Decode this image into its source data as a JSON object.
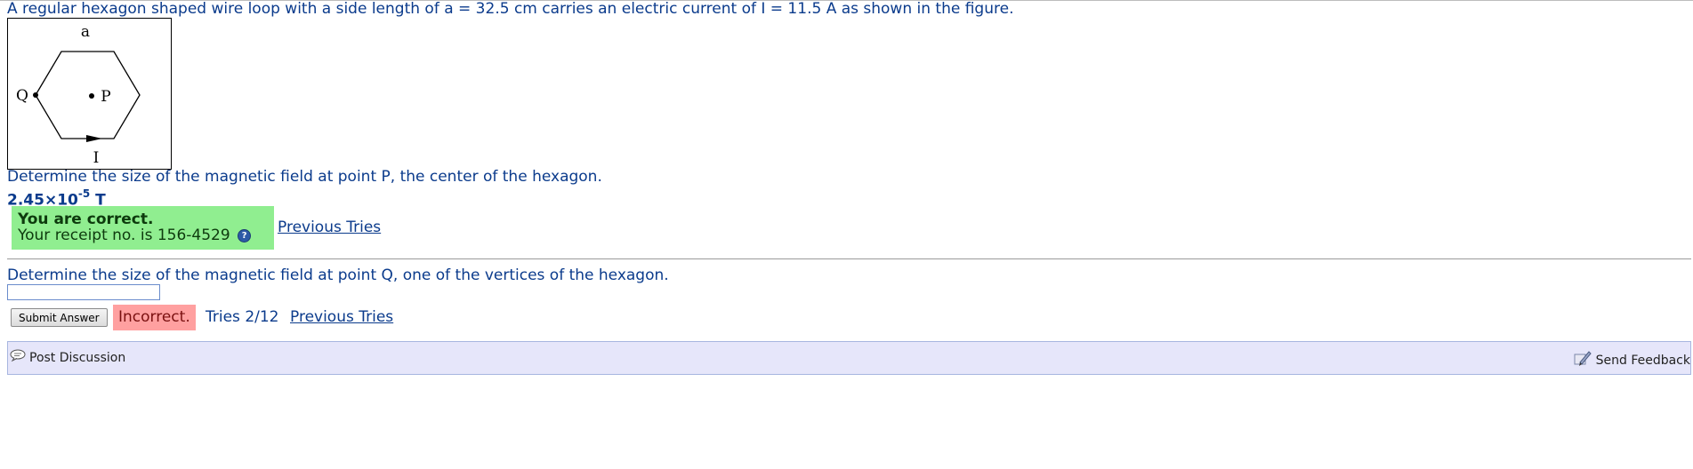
{
  "problem": {
    "statement": "A regular hexagon shaped wire loop with a side length of a = 32.5 cm carries an electric current of I = 11.5 A as shown in the figure."
  },
  "figure": {
    "label_a": "a",
    "label_q": "Q",
    "label_p": "P",
    "label_i": "I"
  },
  "part1": {
    "question": "Determine the size of the magnetic field at point P, the center of the hexagon.",
    "answer_mantissa": "2.45×10",
    "answer_exponent": "-5",
    "answer_unit": "T",
    "status_title": "You are correct.",
    "receipt": "Your receipt no. is 156-4529",
    "help_icon": "question-circle-icon",
    "previous_tries": "Previous Tries"
  },
  "part2": {
    "question": "Determine the size of the magnetic field at point Q, one of the vertices of the hexagon.",
    "input_value": "",
    "submit_label": "Submit Answer",
    "status": "Incorrect.",
    "tries": "Tries 2/12",
    "previous_tries": "Previous Tries"
  },
  "footer": {
    "post_discussion": "Post Discussion",
    "send_feedback": "Send Feedback",
    "post_discussion_icon": "speech-bubble-icon",
    "send_feedback_icon": "pen-feedback-icon"
  },
  "colors": {
    "text": "#0b3b8c",
    "correct_bg": "#90ee90",
    "incorrect_bg": "#ffa0a0",
    "bar_bg": "#e6e6fa"
  }
}
